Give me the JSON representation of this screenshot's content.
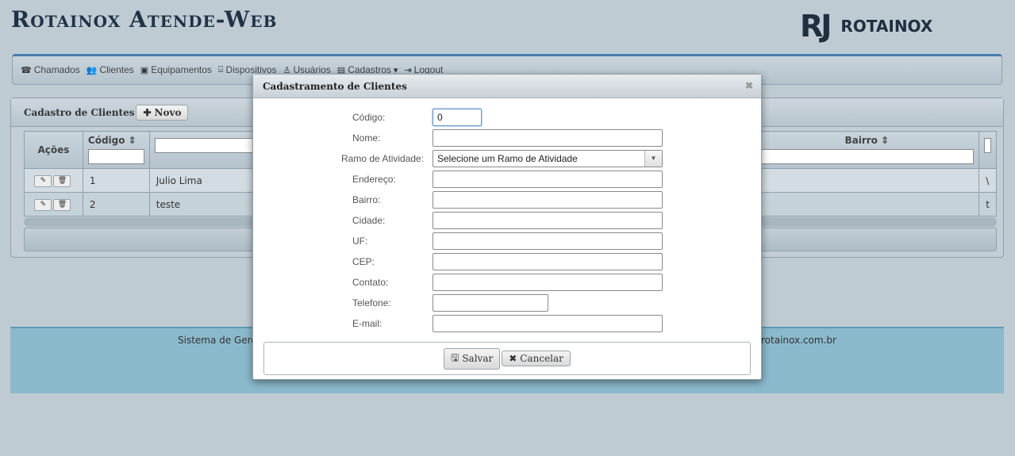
{
  "header": {
    "app_title": "Rotainox Atende-Web",
    "brand_mark": "RJ",
    "brand_name": "ROTAINOX"
  },
  "nav": {
    "items": [
      {
        "icon": "phone-icon",
        "glyph": "☎",
        "label": "Chamados"
      },
      {
        "icon": "users-icon",
        "glyph": "👥",
        "label": "Clientes"
      },
      {
        "icon": "equipment-icon",
        "glyph": "▣",
        "label": "Equipamentos"
      },
      {
        "icon": "device-icon",
        "glyph": "⌸",
        "label": "Dispositivos"
      },
      {
        "icon": "user-lock-icon",
        "glyph": "♙",
        "label": "Usuários"
      },
      {
        "icon": "book-icon",
        "glyph": "▤",
        "label": "Cadastros",
        "caret": "▾"
      },
      {
        "icon": "logout-icon",
        "glyph": "⇥",
        "label": "Logout"
      }
    ]
  },
  "panel": {
    "title": "Cadastro de Clientes",
    "new_button": {
      "icon": "plus-icon",
      "glyph": "✚",
      "label": "Novo"
    },
    "columns": {
      "acoes": "Ações",
      "codigo": "Código",
      "bairro": "Bairro",
      "sort_glyph": "⇕"
    },
    "rows": [
      {
        "codigo": "1",
        "nome": "Julio Lima",
        "bairro_trunc": "\\"
      },
      {
        "codigo": "2",
        "nome": "teste",
        "bairro_trunc": "t"
      }
    ]
  },
  "footer": {
    "left_text": "Sistema de Gerê",
    "right_text": "rotainox.com.br"
  },
  "dialog": {
    "title": "Cadastramento de Clientes",
    "close_glyph": "✖",
    "fields": {
      "codigo": {
        "label": "Código:",
        "value": "0"
      },
      "nome": {
        "label": "Nome:",
        "value": ""
      },
      "ramo": {
        "label": "Ramo de Atividade:",
        "value": "Selecione um Ramo de Atividade"
      },
      "endereco": {
        "label": "Endereço:",
        "value": ""
      },
      "bairro": {
        "label": "Bairro:",
        "value": ""
      },
      "cidade": {
        "label": "Cidade:",
        "value": ""
      },
      "uf": {
        "label": "UF:",
        "value": ""
      },
      "cep": {
        "label": "CEP:",
        "value": ""
      },
      "contato": {
        "label": "Contato:",
        "value": ""
      },
      "telefone": {
        "label": "Telefone:",
        "value": ""
      },
      "email": {
        "label": "E-mail:",
        "value": ""
      }
    },
    "buttons": {
      "save": {
        "icon": "floppy-icon",
        "glyph": "🖫",
        "label": "Salvar"
      },
      "cancel": {
        "icon": "x-icon",
        "glyph": "✖",
        "label": "Cancelar"
      }
    }
  }
}
